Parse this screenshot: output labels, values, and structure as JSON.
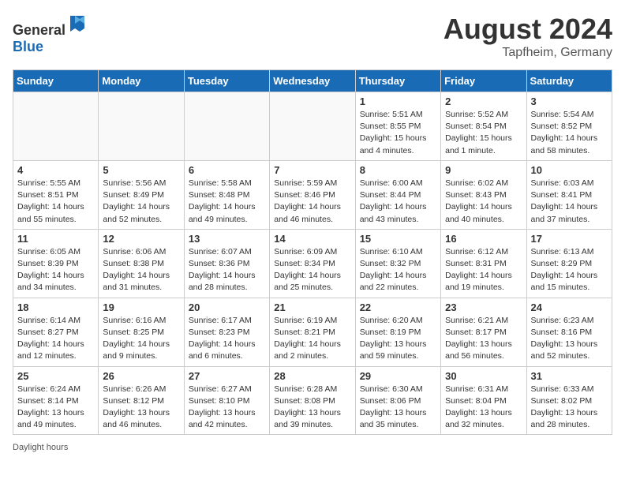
{
  "header": {
    "logo_general": "General",
    "logo_blue": "Blue",
    "month": "August 2024",
    "location": "Tapfheim, Germany"
  },
  "days_of_week": [
    "Sunday",
    "Monday",
    "Tuesday",
    "Wednesday",
    "Thursday",
    "Friday",
    "Saturday"
  ],
  "weeks": [
    [
      {
        "day": "",
        "info": ""
      },
      {
        "day": "",
        "info": ""
      },
      {
        "day": "",
        "info": ""
      },
      {
        "day": "",
        "info": ""
      },
      {
        "day": "1",
        "info": "Sunrise: 5:51 AM\nSunset: 8:55 PM\nDaylight: 15 hours and 4 minutes."
      },
      {
        "day": "2",
        "info": "Sunrise: 5:52 AM\nSunset: 8:54 PM\nDaylight: 15 hours and 1 minute."
      },
      {
        "day": "3",
        "info": "Sunrise: 5:54 AM\nSunset: 8:52 PM\nDaylight: 14 hours and 58 minutes."
      }
    ],
    [
      {
        "day": "4",
        "info": "Sunrise: 5:55 AM\nSunset: 8:51 PM\nDaylight: 14 hours and 55 minutes."
      },
      {
        "day": "5",
        "info": "Sunrise: 5:56 AM\nSunset: 8:49 PM\nDaylight: 14 hours and 52 minutes."
      },
      {
        "day": "6",
        "info": "Sunrise: 5:58 AM\nSunset: 8:48 PM\nDaylight: 14 hours and 49 minutes."
      },
      {
        "day": "7",
        "info": "Sunrise: 5:59 AM\nSunset: 8:46 PM\nDaylight: 14 hours and 46 minutes."
      },
      {
        "day": "8",
        "info": "Sunrise: 6:00 AM\nSunset: 8:44 PM\nDaylight: 14 hours and 43 minutes."
      },
      {
        "day": "9",
        "info": "Sunrise: 6:02 AM\nSunset: 8:43 PM\nDaylight: 14 hours and 40 minutes."
      },
      {
        "day": "10",
        "info": "Sunrise: 6:03 AM\nSunset: 8:41 PM\nDaylight: 14 hours and 37 minutes."
      }
    ],
    [
      {
        "day": "11",
        "info": "Sunrise: 6:05 AM\nSunset: 8:39 PM\nDaylight: 14 hours and 34 minutes."
      },
      {
        "day": "12",
        "info": "Sunrise: 6:06 AM\nSunset: 8:38 PM\nDaylight: 14 hours and 31 minutes."
      },
      {
        "day": "13",
        "info": "Sunrise: 6:07 AM\nSunset: 8:36 PM\nDaylight: 14 hours and 28 minutes."
      },
      {
        "day": "14",
        "info": "Sunrise: 6:09 AM\nSunset: 8:34 PM\nDaylight: 14 hours and 25 minutes."
      },
      {
        "day": "15",
        "info": "Sunrise: 6:10 AM\nSunset: 8:32 PM\nDaylight: 14 hours and 22 minutes."
      },
      {
        "day": "16",
        "info": "Sunrise: 6:12 AM\nSunset: 8:31 PM\nDaylight: 14 hours and 19 minutes."
      },
      {
        "day": "17",
        "info": "Sunrise: 6:13 AM\nSunset: 8:29 PM\nDaylight: 14 hours and 15 minutes."
      }
    ],
    [
      {
        "day": "18",
        "info": "Sunrise: 6:14 AM\nSunset: 8:27 PM\nDaylight: 14 hours and 12 minutes."
      },
      {
        "day": "19",
        "info": "Sunrise: 6:16 AM\nSunset: 8:25 PM\nDaylight: 14 hours and 9 minutes."
      },
      {
        "day": "20",
        "info": "Sunrise: 6:17 AM\nSunset: 8:23 PM\nDaylight: 14 hours and 6 minutes."
      },
      {
        "day": "21",
        "info": "Sunrise: 6:19 AM\nSunset: 8:21 PM\nDaylight: 14 hours and 2 minutes."
      },
      {
        "day": "22",
        "info": "Sunrise: 6:20 AM\nSunset: 8:19 PM\nDaylight: 13 hours and 59 minutes."
      },
      {
        "day": "23",
        "info": "Sunrise: 6:21 AM\nSunset: 8:17 PM\nDaylight: 13 hours and 56 minutes."
      },
      {
        "day": "24",
        "info": "Sunrise: 6:23 AM\nSunset: 8:16 PM\nDaylight: 13 hours and 52 minutes."
      }
    ],
    [
      {
        "day": "25",
        "info": "Sunrise: 6:24 AM\nSunset: 8:14 PM\nDaylight: 13 hours and 49 minutes."
      },
      {
        "day": "26",
        "info": "Sunrise: 6:26 AM\nSunset: 8:12 PM\nDaylight: 13 hours and 46 minutes."
      },
      {
        "day": "27",
        "info": "Sunrise: 6:27 AM\nSunset: 8:10 PM\nDaylight: 13 hours and 42 minutes."
      },
      {
        "day": "28",
        "info": "Sunrise: 6:28 AM\nSunset: 8:08 PM\nDaylight: 13 hours and 39 minutes."
      },
      {
        "day": "29",
        "info": "Sunrise: 6:30 AM\nSunset: 8:06 PM\nDaylight: 13 hours and 35 minutes."
      },
      {
        "day": "30",
        "info": "Sunrise: 6:31 AM\nSunset: 8:04 PM\nDaylight: 13 hours and 32 minutes."
      },
      {
        "day": "31",
        "info": "Sunrise: 6:33 AM\nSunset: 8:02 PM\nDaylight: 13 hours and 28 minutes."
      }
    ]
  ],
  "footer": {
    "label": "Daylight hours"
  }
}
